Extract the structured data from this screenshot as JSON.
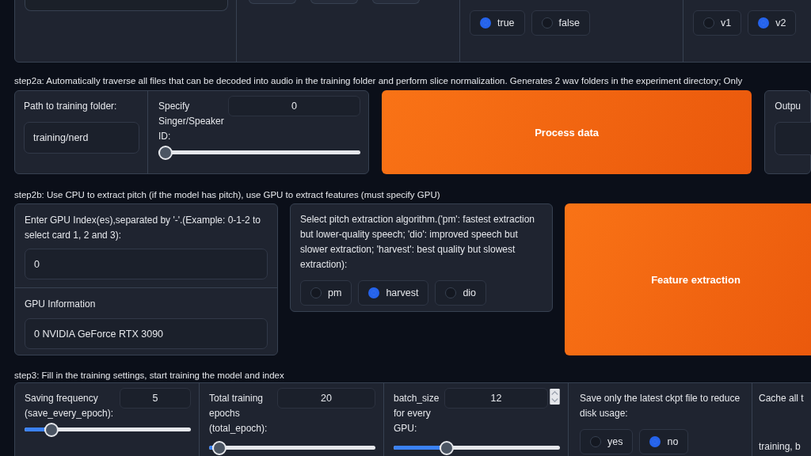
{
  "top_section": {
    "option_a": [
      {
        "label": "true",
        "selected": true
      },
      {
        "label": "false",
        "selected": false
      }
    ],
    "version": [
      {
        "label": "v1",
        "selected": false
      },
      {
        "label": "v2",
        "selected": true
      }
    ]
  },
  "step2a": {
    "heading": "step2a: Automatically traverse all files that can be decoded into audio in the training folder and perform slice normalization. Generates 2 wav folders in the experiment directory; Only",
    "folder": {
      "label": "Path to training folder:",
      "value": "training/nerd"
    },
    "speaker": {
      "label": "Specify Singer/Speaker ID:",
      "value": "0",
      "level": 0
    },
    "process_button": "Process data",
    "output": {
      "label": "Outpu"
    }
  },
  "step2b": {
    "heading": "step2b: Use CPU to extract pitch (if the model has pitch), use GPU to extract features (must specify GPU)",
    "gpu_index": {
      "label": "Enter GPU Index(es),separated by '-'.(Example: 0-1-2 to select card 1, 2 and 3):",
      "value": "0"
    },
    "gpu_info": {
      "label": "GPU Information",
      "value": "0  NVIDIA GeForce RTX 3090"
    },
    "pitch": {
      "label": "Select pitch extraction algorithm.('pm': fastest extraction but lower-quality speech; 'dio': improved speech but slower extraction; 'harvest': best quality but slowest extraction):",
      "options": [
        {
          "label": "pm",
          "selected": false
        },
        {
          "label": "harvest",
          "selected": true
        },
        {
          "label": "dio",
          "selected": false
        }
      ]
    },
    "extract_button": "Feature extraction"
  },
  "step3": {
    "heading": "step3: Fill in the training settings, start training the model and index",
    "sliders": [
      {
        "label": "Saving frequency (save_every_epoch):",
        "value": "5",
        "level": 0.13
      },
      {
        "label": "Total training epochs (total_epoch):",
        "value": "20",
        "level": 0.02
      },
      {
        "label": "batch_size for every GPU:",
        "value": "12",
        "level": 0.3
      }
    ],
    "save_latest": {
      "label": "Save only the latest ckpt file to reduce disk usage:",
      "options": [
        {
          "label": "yes",
          "selected": false
        },
        {
          "label": "no",
          "selected": true
        }
      ]
    },
    "cache": {
      "lines": [
        "Cache all t",
        "training, b"
      ]
    }
  }
}
